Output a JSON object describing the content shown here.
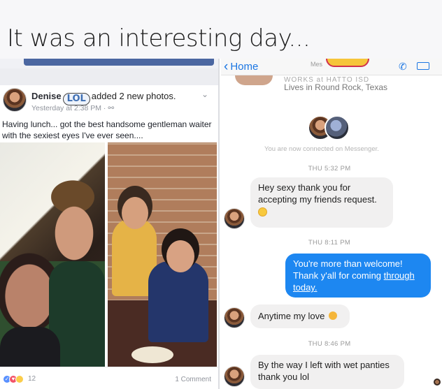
{
  "caption": "It was an interesting day...",
  "facebook": {
    "author": "Denise",
    "sticker": "LOL",
    "action": "added 2 new photos.",
    "timestamp": "Yesterday at 2:38 PM ·",
    "audience_icon": "friends-icon",
    "post_text": "Having lunch... got the best handsome gentleman waiter with the sexiest eyes I've ever seen....",
    "reaction_count": "12",
    "comments": "1 Comment",
    "reactions": [
      "like",
      "love",
      "haha"
    ]
  },
  "messenger": {
    "back_label": "Home",
    "back_icon": "chevron-left-icon",
    "header_sub": "Mes",
    "profile_partial": "WORKS at HATTO ISD",
    "lives": "Lives in Round Rock, Texas",
    "connected": "You are now connected on Messenger.",
    "icons": {
      "call": "phone-icon",
      "video": "video-icon"
    },
    "accent": "#1d87f1",
    "times": [
      "THU 5:32 PM",
      "THU 8:11 PM",
      "THU 8:46 PM"
    ],
    "messages": [
      {
        "from": "them",
        "text": "Hey sexy thank you for accepting my friends request."
      },
      {
        "from": "me",
        "text": "You're more than welcome! Thank y'all for coming ",
        "link": "through today."
      },
      {
        "from": "them",
        "text": "Anytime my love"
      },
      {
        "from": "them",
        "text": "By the way I left with wet panties thank you  lol"
      }
    ]
  }
}
